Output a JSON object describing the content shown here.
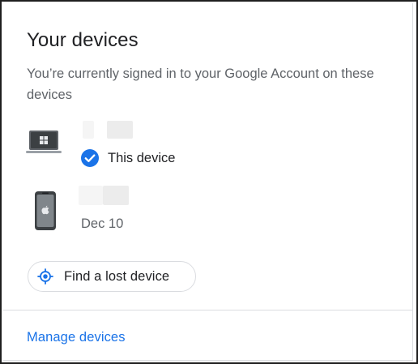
{
  "card": {
    "title": "Your devices",
    "subtitle": "You’re currently signed in to your Google Account on these devices"
  },
  "devices": [
    {
      "icon": "windows-laptop-icon",
      "status_label": "This device",
      "status_icon": "check-circle-icon"
    },
    {
      "icon": "iphone-icon",
      "last_seen": "Dec 10"
    }
  ],
  "actions": {
    "find_lost_device": "Find a lost device",
    "find_icon": "location-target-icon",
    "manage_devices": "Manage devices"
  },
  "colors": {
    "accent": "#1a73e8",
    "title_text": "#202124",
    "secondary_text": "#5f6368",
    "divider": "#dadce0"
  }
}
